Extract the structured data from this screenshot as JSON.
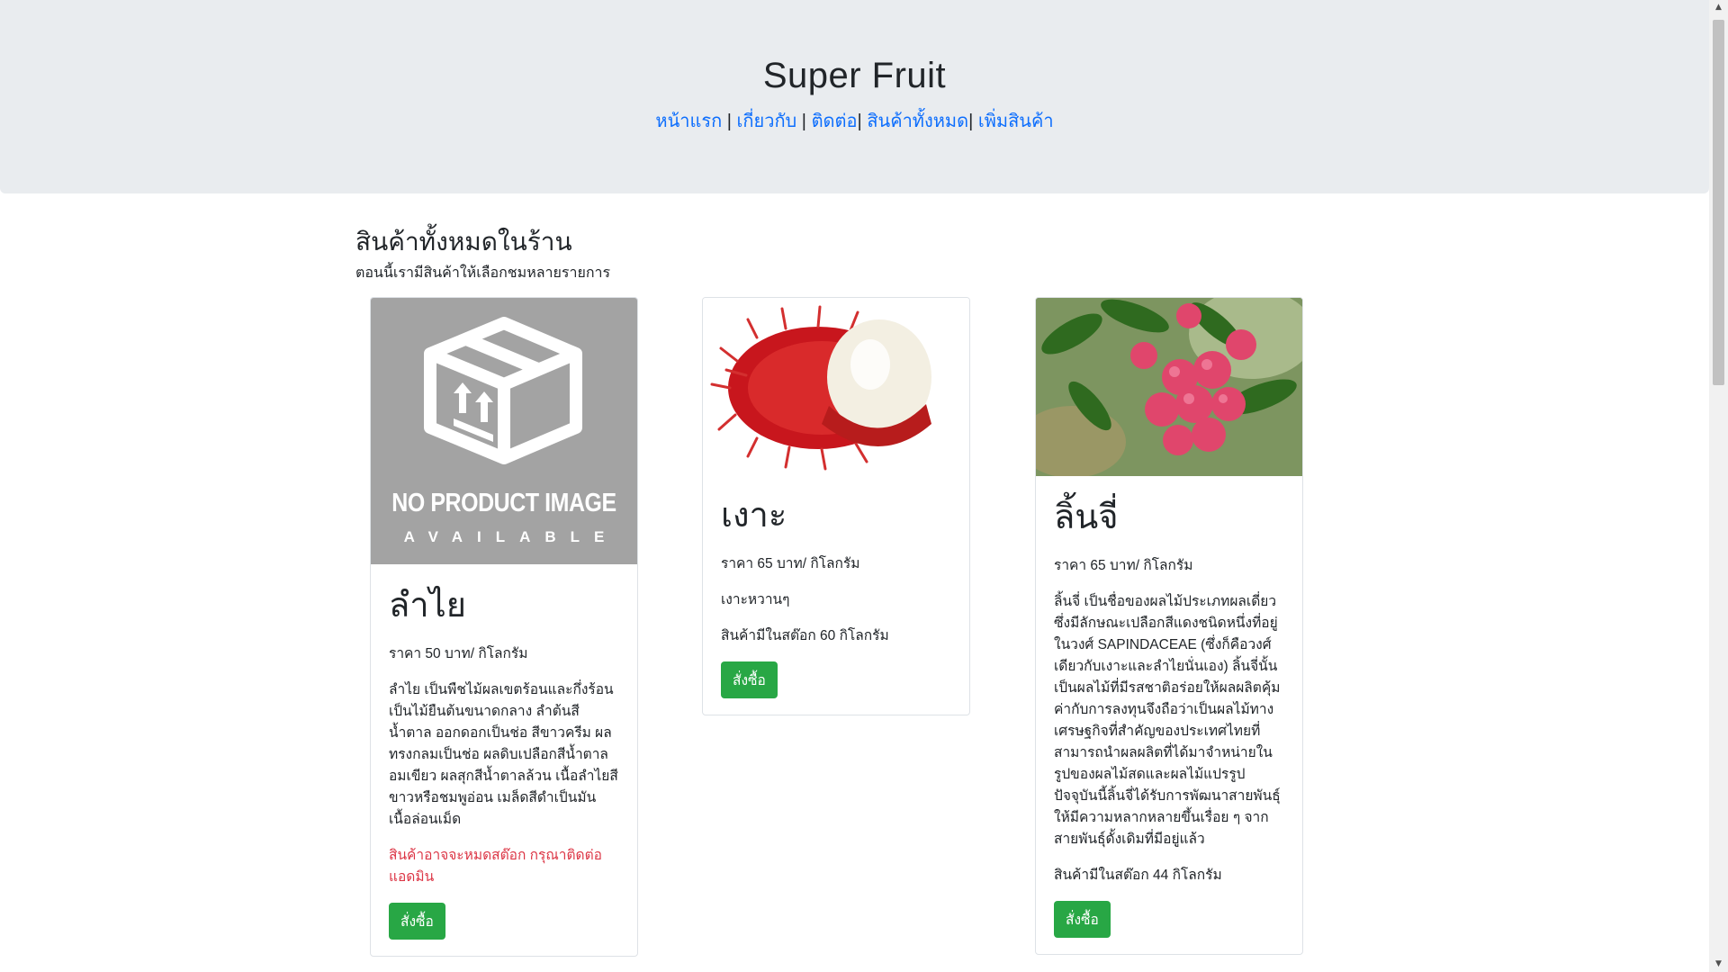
{
  "header": {
    "title": "Super Fruit",
    "nav": [
      {
        "label": "หน้าแรก"
      },
      {
        "label": "เกี่ยวกับ"
      },
      {
        "label": "ติดต่อ"
      },
      {
        "label": "สินค้าทั้งหมด"
      },
      {
        "label": "เพิ่มสินค้า"
      }
    ],
    "separators": [
      " | ",
      " | ",
      "| ",
      "| "
    ]
  },
  "section": {
    "title": "สินค้าทั้งหมดในร้าน",
    "subtitle": "ตอนนี้เรามีสินค้าให้เลือกชมหลายรายการ"
  },
  "products": [
    {
      "name": "ลำไย",
      "price": "ราคา 50 บาท/ กิโลกรัม",
      "description": "ลำไย เป็นพืชไม้ผลเขตร้อนและกึ่งร้อน เป็นไม้ยืนต้นขนาดกลาง ลำต้นสีน้ำตาล ออกดอกเป็นช่อ สีขาวครีม ผลทรงกลมเป็นช่อ ผลดิบเปลือกสีน้ำตาลอมเขียว ผลสุกสีน้ำตาลล้วน เนื้อลำไยสีขาวหรือชมพูอ่อน เมล็ดสีดำเป็นมัน เนื้อล่อนเม็ด",
      "warning": "สินค้าอาจจะหมดสต๊อก กรุณาติดต่อแอดมิน",
      "image": {
        "line1": "NO PRODUCT IMAGE",
        "line2": "AVAILABLE"
      },
      "button": "สั่งซื้อ"
    },
    {
      "name": "เงาะ",
      "price": "ราคา 65 บาท/ กิโลกรัม",
      "description": "เงาะหวานๆ",
      "stock": "สินค้ามีในสต๊อก 60 กิโลกรัม",
      "button": "สั่งซื้อ"
    },
    {
      "name": "ลิ้นจี่",
      "price": "ราคา 65 บาท/ กิโลกรัม",
      "description": "ลิ้นจี่ เป็นชื่อของผลไม้ประเภทผลเดี่ยว ซึ่งมีลักษณะเปลือกสีแดงชนิดหนึ่งที่อยู่ในวงศ์ SAPINDACEAE (ซึ่งก็คือวงศ์เดียวกับเงาะและลำไยนั่นเอง) ลิ้นจี่นั้นเป็นผลไม้ที่มีรสชาติอร่อยให้ผลผลิตคุ้มค่ากับการลงทุนจึงถือว่าเป็นผลไม้ทางเศรษฐกิจที่สำคัญของประเทศไทยที่สามารถนำผลผลิตที่ได้มาจำหน่ายในรูปของผลไม้สดและผลไม้แปรรูป ปัจจุบันนี้ลิ้นจี่ได้รับการพัฒนาสายพันธุ์ให้มีความหลากหลายขึ้นเรื่อย ๆ จากสายพันธุ์ดั้งเดิมที่มีอยู่แล้ว",
      "stock": "สินค้ามีในสต๊อก 44 กิโลกรัม",
      "button": "สั่งซื้อ"
    }
  ],
  "colors": {
    "link": "#0d6efd",
    "button": "#28a745",
    "warning": "#dc3545",
    "jumbotron": "#e9ecef"
  }
}
